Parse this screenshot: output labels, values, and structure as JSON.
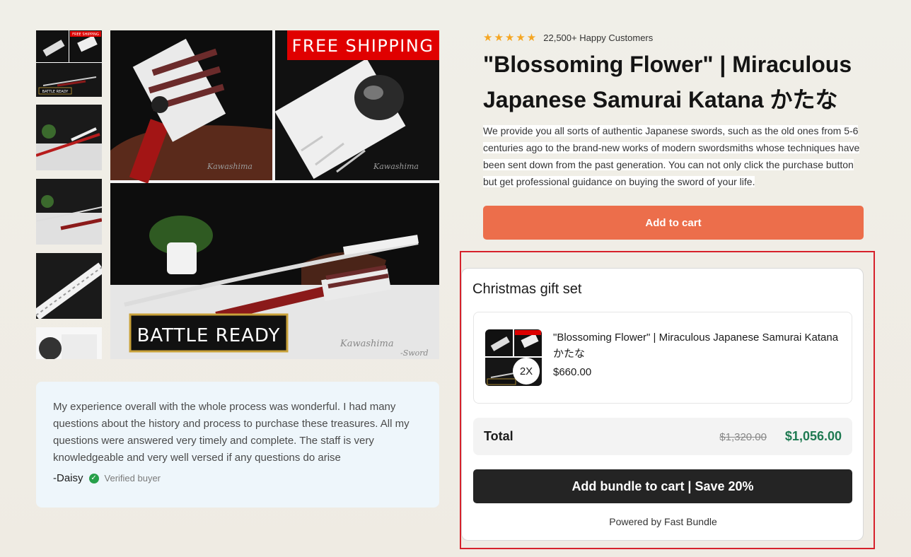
{
  "gallery": {
    "thumbnails": [
      {
        "name": "thumbnail-1-collage",
        "active": true
      },
      {
        "name": "thumbnail-2"
      },
      {
        "name": "thumbnail-3"
      },
      {
        "name": "thumbnail-4"
      },
      {
        "name": "thumbnail-5"
      }
    ],
    "thumb_text": {
      "free_shipping": "FREE SHIPPING",
      "battle_ready": "BATTLE READY"
    },
    "main_image": {
      "free_shipping_banner": "FREE SHIPPING",
      "battle_ready_banner": "BATTLE READY",
      "watermark_1": "Kawashima",
      "watermark_2": "-Sword"
    }
  },
  "review": {
    "text": "My experience overall with the whole process was wonderful. I had many questions about the history and process to purchase these treasures. All my questions were answered very timely and complete. The staff is very knowledgeable and very well versed if any questions do arise",
    "author": "-Daisy",
    "verified_label": "Verified buyer"
  },
  "product": {
    "stars": "★★★★★",
    "rating_text": "22,500+ Happy Customers",
    "title": "\"Blossoming Flower\" | Miraculous Japanese Samurai Katana かたな",
    "description": "We provide you all sorts of authentic Japanese swords, such as the old ones from 5-6 centuries ago to the brand-new works of modern swordsmiths whose techniques have been sent down from the past generation. You can not only click the purchase button but get professional guidance on buying the sword of your life.",
    "add_to_cart_label": "Add to cart",
    "colors": {
      "accent": "#ec6e4b",
      "star": "#f5a623"
    }
  },
  "bundle": {
    "title": "Christmas gift set",
    "item": {
      "name": "\"Blossoming Flower\" | Miraculous Japanese Samurai Katana かたな",
      "price": "$660.00",
      "quantity": "2X"
    },
    "total_label": "Total",
    "original_price": "$1,320.00",
    "discounted_price": "$1,056.00",
    "button_label": "Add bundle to cart | Save 20%",
    "powered_by": "Powered by Fast Bundle",
    "colors": {
      "highlight": "#d6212b",
      "price": "#1f7a52",
      "button": "#242424"
    }
  }
}
